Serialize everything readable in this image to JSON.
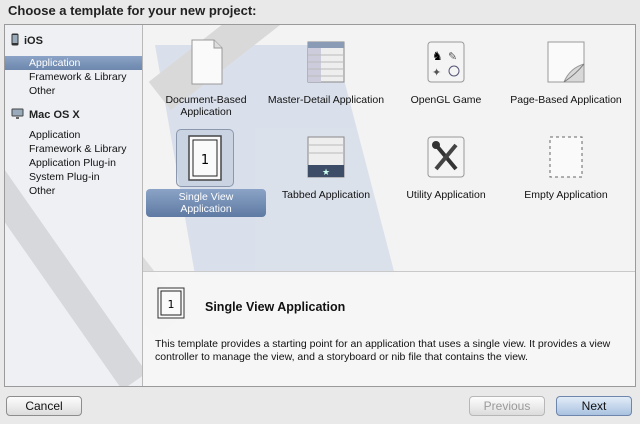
{
  "dialog": {
    "title": "Choose a template for your new project:"
  },
  "sidebar": {
    "sections": [
      {
        "header": "iOS",
        "icon": "iphone-icon",
        "items": [
          "Application",
          "Framework & Library",
          "Other"
        ],
        "selected_item": "Application"
      },
      {
        "header": "Mac OS X",
        "icon": "mac-icon",
        "items": [
          "Application",
          "Framework & Library",
          "Application Plug-in",
          "System Plug-in",
          "Other"
        ]
      }
    ]
  },
  "templates": [
    {
      "label": "Document-Based Application",
      "icon": "document-icon"
    },
    {
      "label": "Master-Detail Application",
      "icon": "master-detail-icon"
    },
    {
      "label": "OpenGL Game",
      "icon": "opengl-game-icon"
    },
    {
      "label": "Page-Based Application",
      "icon": "page-curl-icon"
    },
    {
      "label": "Single View Application",
      "icon": "single-view-icon",
      "selected": true
    },
    {
      "label": "Tabbed Application",
      "icon": "tabbed-icon"
    },
    {
      "label": "Utility Application",
      "icon": "tools-icon"
    },
    {
      "label": "Empty Application",
      "icon": "empty-dashed-icon"
    }
  ],
  "description": {
    "title": "Single View Application",
    "text": "This template provides a starting point for an application that uses a single view. It provides a view controller to manage the view, and a storyboard or nib file that contains the view.",
    "icon_text": "1"
  },
  "buttons": {
    "cancel": "Cancel",
    "previous": "Previous",
    "next": "Next"
  },
  "colors": {
    "selection": "#6d87ad",
    "background": "#e9e9e9"
  }
}
